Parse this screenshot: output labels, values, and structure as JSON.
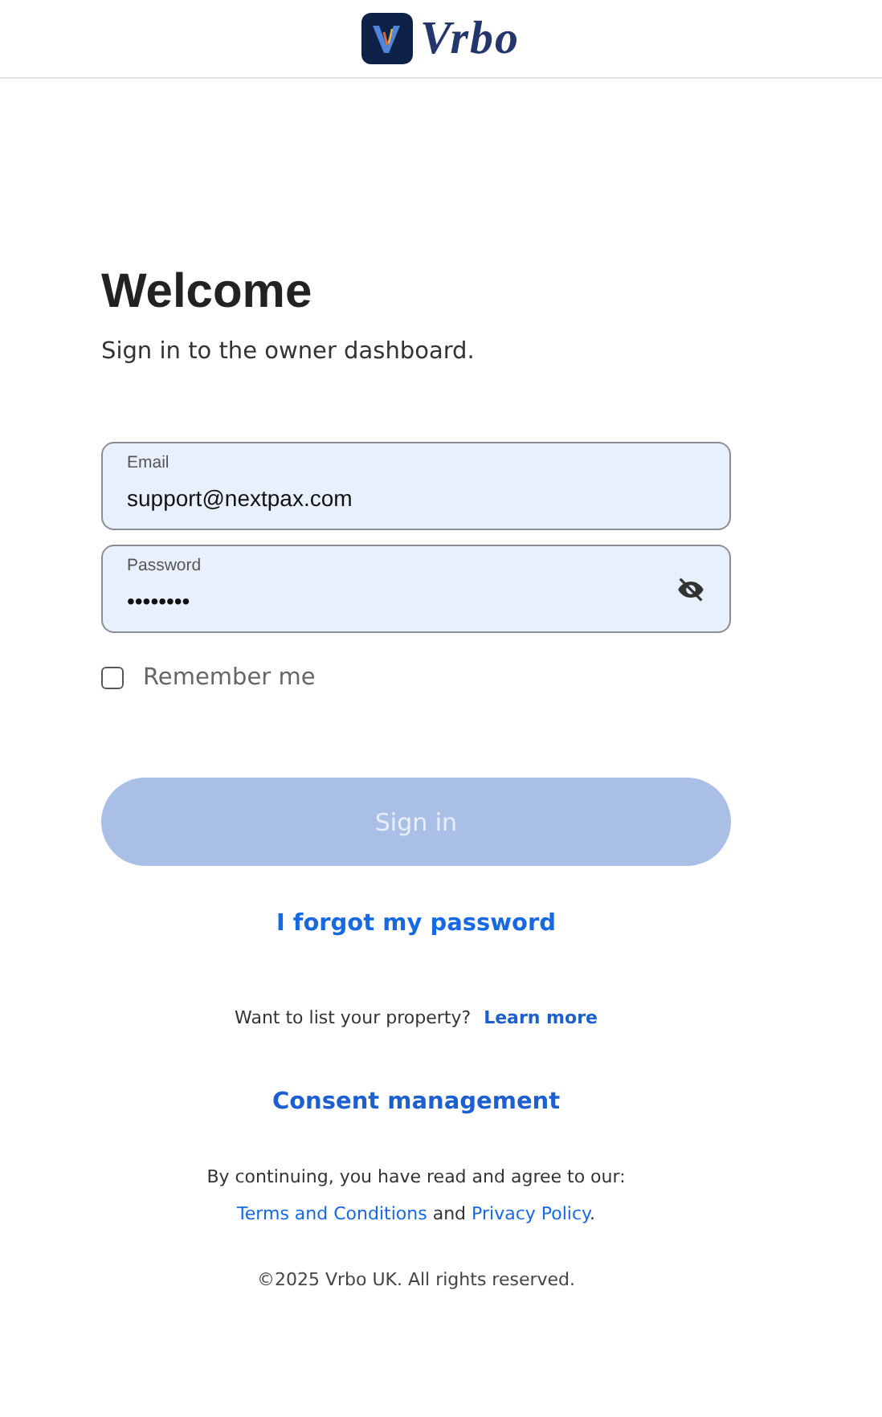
{
  "header": {
    "logo_text": "Vrbo"
  },
  "heading": "Welcome",
  "subtitle": "Sign in to the owner dashboard.",
  "fields": [
    {
      "kind": "email",
      "label": "Email",
      "value": "support@nextpax.com"
    },
    {
      "kind": "password",
      "label": "Password",
      "value": "••••••••"
    }
  ],
  "remember": {
    "label": "Remember me",
    "checked": false
  },
  "sign_in": {
    "label": "Sign in",
    "disabled": true
  },
  "forgot_link": "I forgot my password",
  "list_property": {
    "text": "Want to list your property?",
    "link": "Learn more"
  },
  "consent_link": "Consent management",
  "legal": {
    "intro": "By continuing, you have read and agree to our:",
    "terms": "Terms and Conditions",
    "joiner": "and",
    "privacy": "Privacy Policy",
    "end": "."
  },
  "copyright": "©2025 Vrbo UK. All rights reserved."
}
